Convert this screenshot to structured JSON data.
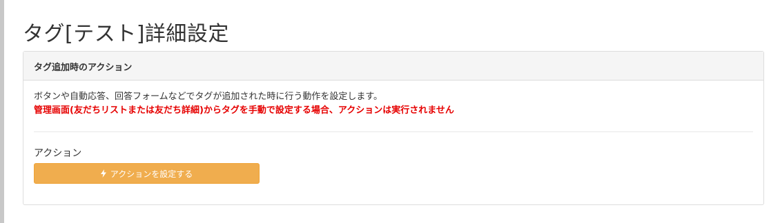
{
  "page": {
    "title": "タグ[テスト]詳細設定"
  },
  "panel": {
    "heading": "タグ追加時のアクション",
    "description": "ボタンや自動応答、回答フォームなどでタグが追加された時に行う動作を設定します。",
    "warning": "管理画面(友だちリストまたは友だち詳細)からタグを手動で設定する場合、アクションは実行されません",
    "action_label": "アクション",
    "action_button_label": "アクションを設定する",
    "action_button_icon": "bolt-icon"
  },
  "colors": {
    "warning": "#e60000",
    "button": "#f0ad4e",
    "button_text": "#ffffff",
    "heading_bg": "#f5f5f5"
  }
}
